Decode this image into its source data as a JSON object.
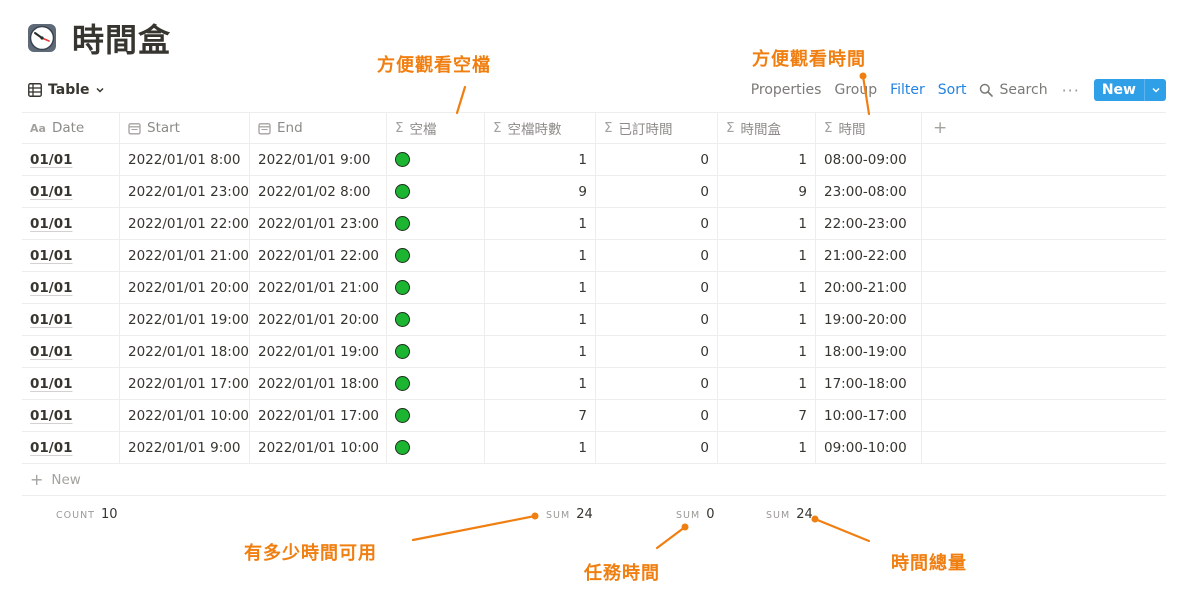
{
  "page": {
    "title": "時間盒",
    "icon": "alarm-clock-icon"
  },
  "toolbar": {
    "view_label": "Table",
    "properties": "Properties",
    "group": "Group",
    "filter": "Filter",
    "sort": "Sort",
    "search": "Search",
    "more": "···",
    "new_label": "New"
  },
  "columns": [
    {
      "name": "Date",
      "icon": "text-aa-icon"
    },
    {
      "name": "Start",
      "icon": "calendar-icon"
    },
    {
      "name": "End",
      "icon": "calendar-icon"
    },
    {
      "name": "空檔",
      "icon": "sigma-icon"
    },
    {
      "name": "空檔時數",
      "icon": "sigma-icon"
    },
    {
      "name": "已訂時間",
      "icon": "sigma-icon"
    },
    {
      "name": "時間盒",
      "icon": "sigma-icon"
    },
    {
      "name": "時間",
      "icon": "sigma-icon"
    }
  ],
  "rows": [
    {
      "date": "01/01",
      "start": "2022/01/01 8:00",
      "end": "2022/01/01 9:00",
      "free_hours": "1",
      "booked": "0",
      "box": "1",
      "time": "08:00-09:00"
    },
    {
      "date": "01/01",
      "start": "2022/01/01 23:00",
      "end": "2022/01/02 8:00",
      "free_hours": "9",
      "booked": "0",
      "box": "9",
      "time": "23:00-08:00"
    },
    {
      "date": "01/01",
      "start": "2022/01/01 22:00",
      "end": "2022/01/01 23:00",
      "free_hours": "1",
      "booked": "0",
      "box": "1",
      "time": "22:00-23:00"
    },
    {
      "date": "01/01",
      "start": "2022/01/01 21:00",
      "end": "2022/01/01 22:00",
      "free_hours": "1",
      "booked": "0",
      "box": "1",
      "time": "21:00-22:00"
    },
    {
      "date": "01/01",
      "start": "2022/01/01 20:00",
      "end": "2022/01/01 21:00",
      "free_hours": "1",
      "booked": "0",
      "box": "1",
      "time": "20:00-21:00"
    },
    {
      "date": "01/01",
      "start": "2022/01/01 19:00",
      "end": "2022/01/01 20:00",
      "free_hours": "1",
      "booked": "0",
      "box": "1",
      "time": "19:00-20:00"
    },
    {
      "date": "01/01",
      "start": "2022/01/01 18:00",
      "end": "2022/01/01 19:00",
      "free_hours": "1",
      "booked": "0",
      "box": "1",
      "time": "18:00-19:00"
    },
    {
      "date": "01/01",
      "start": "2022/01/01 17:00",
      "end": "2022/01/01 18:00",
      "free_hours": "1",
      "booked": "0",
      "box": "1",
      "time": "17:00-18:00"
    },
    {
      "date": "01/01",
      "start": "2022/01/01 10:00",
      "end": "2022/01/01 17:00",
      "free_hours": "7",
      "booked": "0",
      "box": "7",
      "time": "10:00-17:00"
    },
    {
      "date": "01/01",
      "start": "2022/01/01 9:00",
      "end": "2022/01/01 10:00",
      "free_hours": "1",
      "booked": "0",
      "box": "1",
      "time": "09:00-10:00"
    }
  ],
  "free_dot_color": "#1cb531",
  "new_row_label": "New",
  "footer": {
    "count_label": "COUNT",
    "count_value": "10",
    "sum1_label": "SUM",
    "sum1_value": "24",
    "sum2_label": "SUM",
    "sum2_value": "0",
    "sum3_label": "SUM",
    "sum3_value": "24"
  },
  "annotations": {
    "free_view": "方便觀看空檔",
    "time_view": "方便觀看時間",
    "available": "有多少時間可用",
    "task_time": "任務時間",
    "total_time": "時間總量",
    "color": "#f07f12"
  }
}
